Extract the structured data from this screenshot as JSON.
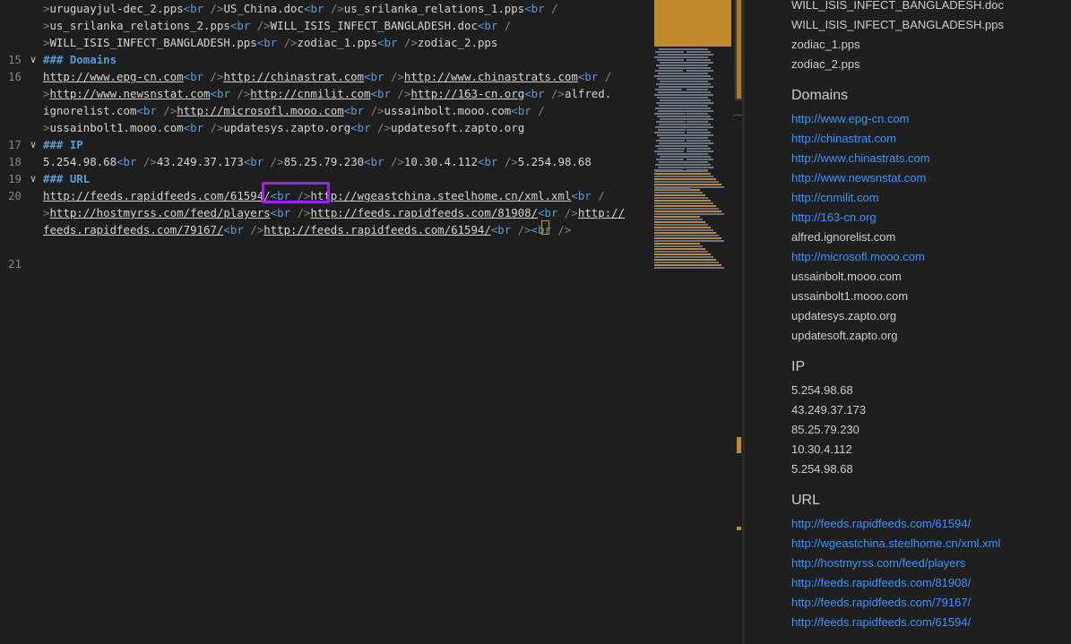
{
  "editor": {
    "lines": [
      {
        "num": "",
        "fold": false,
        "tokens": [
          {
            "c": "p",
            "t": ">"
          },
          {
            "c": "t",
            "t": "uruguayjul-dec_2.pps"
          },
          {
            "c": "g",
            "t": "<br "
          },
          {
            "c": "p",
            "t": "/"
          },
          {
            "c": "p",
            "t": ">"
          },
          {
            "c": "t",
            "t": "US_China.doc"
          },
          {
            "c": "g",
            "t": "<br "
          },
          {
            "c": "p",
            "t": "/"
          },
          {
            "c": "p",
            "t": ">"
          },
          {
            "c": "t",
            "t": "us_srilanka_relations_1.pps"
          },
          {
            "c": "g",
            "t": "<br "
          },
          {
            "c": "p",
            "t": "/"
          }
        ]
      },
      {
        "num": "",
        "fold": false,
        "tokens": [
          {
            "c": "p",
            "t": ">"
          },
          {
            "c": "t",
            "t": "us_srilanka_relations_2.pps"
          },
          {
            "c": "g",
            "t": "<br "
          },
          {
            "c": "p",
            "t": "/"
          },
          {
            "c": "p",
            "t": ">"
          },
          {
            "c": "t",
            "t": "WILL_ISIS_INFECT_BANGLADESH.doc"
          },
          {
            "c": "g",
            "t": "<br "
          },
          {
            "c": "p",
            "t": "/"
          }
        ]
      },
      {
        "num": "",
        "fold": false,
        "tokens": [
          {
            "c": "p",
            "t": ">"
          },
          {
            "c": "t",
            "t": "WILL_ISIS_INFECT_BANGLADESH.pps"
          },
          {
            "c": "g",
            "t": "<br "
          },
          {
            "c": "p",
            "t": "/"
          },
          {
            "c": "p",
            "t": ">"
          },
          {
            "c": "t",
            "t": "zodiac_1.pps"
          },
          {
            "c": "g",
            "t": "<br "
          },
          {
            "c": "p",
            "t": "/"
          },
          {
            "c": "p",
            "t": ">"
          },
          {
            "c": "t",
            "t": "zodiac_2.pps"
          }
        ]
      },
      {
        "num": "15",
        "fold": true,
        "tokens": [
          {
            "c": "h",
            "t": "### Domains"
          }
        ]
      },
      {
        "num": "16",
        "fold": false,
        "tokens": [
          {
            "c": "u",
            "t": "http://www.epg-cn.com"
          },
          {
            "c": "g",
            "t": "<br "
          },
          {
            "c": "p",
            "t": "/"
          },
          {
            "c": "p",
            "t": ">"
          },
          {
            "c": "u",
            "t": "http://chinastrat.com"
          },
          {
            "c": "g",
            "t": "<br "
          },
          {
            "c": "p",
            "t": "/"
          },
          {
            "c": "p",
            "t": ">"
          },
          {
            "c": "u",
            "t": "http://www.chinastrats.com"
          },
          {
            "c": "g",
            "t": "<br "
          },
          {
            "c": "p",
            "t": "/"
          }
        ]
      },
      {
        "num": "",
        "fold": false,
        "tokens": [
          {
            "c": "p",
            "t": ">"
          },
          {
            "c": "u",
            "t": "http://www.newsnstat.com"
          },
          {
            "c": "g",
            "t": "<br "
          },
          {
            "c": "p",
            "t": "/"
          },
          {
            "c": "p",
            "t": ">"
          },
          {
            "c": "u",
            "t": "http://cnmilit.com"
          },
          {
            "c": "g",
            "t": "<br "
          },
          {
            "c": "p",
            "t": "/"
          },
          {
            "c": "p",
            "t": ">"
          },
          {
            "c": "u",
            "t": "http://163-cn.org"
          },
          {
            "c": "g",
            "t": "<br "
          },
          {
            "c": "p",
            "t": "/"
          },
          {
            "c": "p",
            "t": ">"
          },
          {
            "c": "t",
            "t": "alfred."
          }
        ]
      },
      {
        "num": "",
        "fold": false,
        "tokens": [
          {
            "c": "t",
            "t": "ignorelist.com"
          },
          {
            "c": "g",
            "t": "<br "
          },
          {
            "c": "p",
            "t": "/"
          },
          {
            "c": "p",
            "t": ">"
          },
          {
            "c": "u",
            "t": "http://microsofl.mooo.com"
          },
          {
            "c": "g",
            "t": "<br "
          },
          {
            "c": "p",
            "t": "/"
          },
          {
            "c": "p",
            "t": ">"
          },
          {
            "c": "t",
            "t": "ussainbolt.mooo.com"
          },
          {
            "c": "g",
            "t": "<br "
          },
          {
            "c": "p",
            "t": "/"
          }
        ]
      },
      {
        "num": "",
        "fold": false,
        "tokens": [
          {
            "c": "p",
            "t": ">"
          },
          {
            "c": "t",
            "t": "ussainbolt1.mooo.com"
          },
          {
            "c": "g",
            "t": "<br "
          },
          {
            "c": "p",
            "t": "/"
          },
          {
            "c": "p",
            "t": ">"
          },
          {
            "c": "t",
            "t": "updatesys.zapto.org"
          },
          {
            "c": "g",
            "t": "<br "
          },
          {
            "c": "p",
            "t": "/"
          },
          {
            "c": "p",
            "t": ">"
          },
          {
            "c": "t",
            "t": "updatesoft.zapto.org"
          }
        ]
      },
      {
        "num": "17",
        "fold": true,
        "tokens": [
          {
            "c": "h",
            "t": "### IP"
          }
        ]
      },
      {
        "num": "18",
        "fold": false,
        "tokens": [
          {
            "c": "t",
            "t": "5.254.98.68"
          },
          {
            "c": "g",
            "t": "<br "
          },
          {
            "c": "p",
            "t": "/"
          },
          {
            "c": "p",
            "t": ">"
          },
          {
            "c": "t",
            "t": "43.249.37.173"
          },
          {
            "c": "g",
            "t": "<br "
          },
          {
            "c": "p",
            "t": "/"
          },
          {
            "c": "p",
            "t": ">"
          },
          {
            "c": "t",
            "t": "85.25.79.230"
          },
          {
            "c": "g",
            "t": "<br "
          },
          {
            "c": "p",
            "t": "/"
          },
          {
            "c": "p",
            "t": ">"
          },
          {
            "c": "t",
            "t": "10.30.4.112"
          },
          {
            "c": "g",
            "t": "<br "
          },
          {
            "c": "p",
            "t": "/"
          },
          {
            "c": "p",
            "t": ">"
          },
          {
            "c": "t",
            "t": "5.254.98.68"
          }
        ]
      },
      {
        "num": "19",
        "fold": true,
        "tokens": [
          {
            "c": "h",
            "t": "### URL"
          }
        ]
      },
      {
        "num": "20",
        "fold": false,
        "tokens": [
          {
            "c": "u",
            "t": "http://feeds.rapidfeeds.com/61594/"
          },
          {
            "c": "g",
            "t": "<br "
          },
          {
            "c": "p",
            "t": "/"
          },
          {
            "c": "p",
            "t": ">"
          },
          {
            "c": "u",
            "t": "http://wgeastchina.steelhome.cn/xml.xml"
          },
          {
            "c": "g",
            "t": "<br "
          },
          {
            "c": "p",
            "t": "/"
          }
        ]
      },
      {
        "num": "",
        "fold": false,
        "tokens": [
          {
            "c": "p",
            "t": ">"
          },
          {
            "c": "u",
            "t": "http://hostmyrss.com/feed/players"
          },
          {
            "c": "g",
            "t": "<br "
          },
          {
            "c": "p",
            "t": "/"
          },
          {
            "c": "p",
            "t": ">"
          },
          {
            "c": "u",
            "t": "http://feeds.rapidfeeds.com/81908/"
          },
          {
            "c": "g",
            "t": "<br "
          },
          {
            "c": "p",
            "t": "/"
          },
          {
            "c": "p",
            "t": ">"
          },
          {
            "c": "u",
            "t": "http://"
          }
        ]
      },
      {
        "num": "",
        "fold": false,
        "tokens": [
          {
            "c": "u",
            "t": "feeds.rapidfeeds.com/79167/"
          },
          {
            "c": "g",
            "t": "<br "
          },
          {
            "c": "p",
            "t": "/"
          },
          {
            "c": "p",
            "t": ">"
          },
          {
            "c": "u",
            "t": "http://feeds.rapidfeeds.com/61594/"
          },
          {
            "c": "g",
            "t": "<br "
          },
          {
            "c": "p",
            "t": "/"
          },
          {
            "c": "p",
            "t": ">"
          },
          {
            "c": "g",
            "t": "<br "
          },
          {
            "c": "p",
            "t": "/"
          },
          {
            "c": "p",
            "t": ">"
          }
        ]
      },
      {
        "num": "",
        "fold": false,
        "tokens": []
      },
      {
        "num": "21",
        "fold": false,
        "tokens": []
      }
    ]
  },
  "preview": {
    "top_items": [
      "WILL_ISIS_INFECT_BANGLADESH.doc",
      "WILL_ISIS_INFECT_BANGLADESH.pps",
      "zodiac_1.pps",
      "zodiac_2.pps"
    ],
    "domains_heading": "Domains",
    "domains": [
      {
        "text": "http://www.epg-cn.com",
        "link": true
      },
      {
        "text": "http://chinastrat.com",
        "link": true
      },
      {
        "text": "http://www.chinastrats.com",
        "link": true
      },
      {
        "text": "http://www.newsnstat.com",
        "link": true
      },
      {
        "text": "http://cnmilit.com",
        "link": true
      },
      {
        "text": "http://163-cn.org",
        "link": true
      },
      {
        "text": "alfred.ignorelist.com",
        "link": false
      },
      {
        "text": "http://microsofl.mooo.com",
        "link": true
      },
      {
        "text": "ussainbolt.mooo.com",
        "link": false
      },
      {
        "text": "ussainbolt1.mooo.com",
        "link": false
      },
      {
        "text": "updatesys.zapto.org",
        "link": false
      },
      {
        "text": "updatesoft.zapto.org",
        "link": false
      }
    ],
    "ip_heading": "IP",
    "ips": [
      "5.254.98.68",
      "43.249.37.173",
      "85.25.79.230",
      "10.30.4.112",
      "5.254.98.68"
    ],
    "url_heading": "URL",
    "urls": [
      "http://feeds.rapidfeeds.com/61594/",
      "http://wgeastchina.steelhome.cn/xml.xml",
      "http://hostmyrss.com/feed/players",
      "http://feeds.rapidfeeds.com/81908/",
      "http://feeds.rapidfeeds.com/79167/",
      "http://feeds.rapidfeeds.com/61594/"
    ]
  },
  "colors": {
    "highlight_border": "#a020f0",
    "link": "#3794ff",
    "tag": "#569cd6"
  },
  "icons": {
    "fold": "chevron-down-icon"
  }
}
